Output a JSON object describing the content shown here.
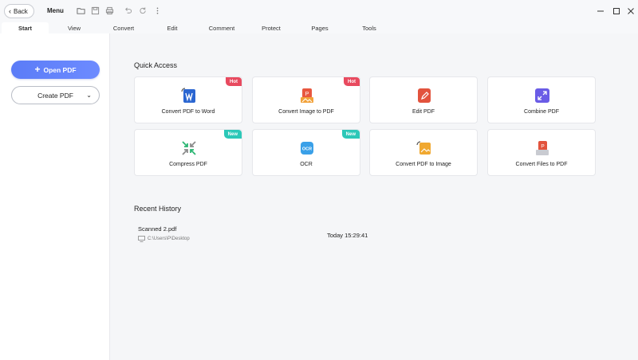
{
  "titlebar": {
    "back_label": "Back",
    "menu_label": "Menu"
  },
  "tabs": [
    {
      "label": "Start",
      "active": true
    },
    {
      "label": "View"
    },
    {
      "label": "Convert"
    },
    {
      "label": "Edit"
    },
    {
      "label": "Comment"
    },
    {
      "label": "Protect"
    },
    {
      "label": "Pages"
    },
    {
      "label": "Tools"
    }
  ],
  "sidebar": {
    "open_label": "Open PDF",
    "create_label": "Create PDF"
  },
  "quick_access": {
    "title": "Quick Access",
    "cards": [
      {
        "label": "Convert PDF to Word",
        "badge": "Hot",
        "icon": "pdf-to-word-icon"
      },
      {
        "label": "Convert Image to PDF",
        "badge": "Hot",
        "icon": "image-to-pdf-icon"
      },
      {
        "label": "Edit PDF",
        "badge": "",
        "icon": "edit-pdf-icon"
      },
      {
        "label": "Combine PDF",
        "badge": "",
        "icon": "combine-pdf-icon"
      },
      {
        "label": "Compress PDF",
        "badge": "New",
        "icon": "compress-pdf-icon"
      },
      {
        "label": "OCR",
        "badge": "New",
        "icon": "ocr-icon"
      },
      {
        "label": "Convert PDF to Image",
        "badge": "",
        "icon": "pdf-to-image-icon"
      },
      {
        "label": "Convert Files to PDF",
        "badge": "",
        "icon": "files-to-pdf-icon"
      }
    ]
  },
  "recent_history": {
    "title": "Recent History",
    "items": [
      {
        "name": "Scanned 2.pdf",
        "path": "C:\\Users\\P\\Desktop",
        "time": "Today 15:29:41"
      }
    ]
  },
  "colors": {
    "accent": "#5b7cf7",
    "hot_badge": "#e84a5f",
    "new_badge": "#2cc8b8"
  }
}
